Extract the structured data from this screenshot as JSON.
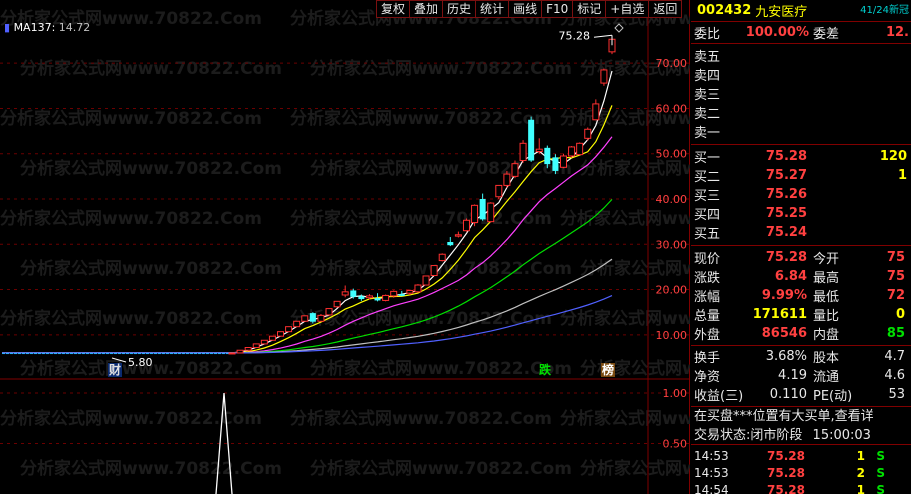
{
  "toolbar": [
    "复权",
    "叠加",
    "历史",
    "统计",
    "画线",
    "F10",
    "标记",
    "+自选",
    "返回"
  ],
  "ma_label": "MA137:",
  "ma_value": "14.72",
  "price_axis": [
    "70.00",
    "60.00",
    "50.00",
    "40.00",
    "30.00",
    "20.00",
    "10.00"
  ],
  "vol_axis": [
    "1.00",
    "0.50"
  ],
  "high_label": "75.28",
  "low_label": "5.80",
  "tags": {
    "cai": "财",
    "die": "跌",
    "bang": "榜"
  },
  "watermark": "分析家公式网www.70822.Com",
  "stock": {
    "code": "002432",
    "name": "九安医疗",
    "badge": "41/24新冠"
  },
  "weibi": {
    "label": "委比",
    "value": "100.00%",
    "label2": "委差",
    "value2": "12."
  },
  "sell": [
    "卖五",
    "卖四",
    "卖三",
    "卖二",
    "卖一"
  ],
  "buy": [
    {
      "label": "买一",
      "price": "75.28",
      "vol": "120"
    },
    {
      "label": "买二",
      "price": "75.27",
      "vol": "1"
    },
    {
      "label": "买三",
      "price": "75.26",
      "vol": ""
    },
    {
      "label": "买四",
      "price": "75.25",
      "vol": ""
    },
    {
      "label": "买五",
      "price": "75.24",
      "vol": ""
    }
  ],
  "quote": [
    {
      "l1": "现价",
      "v1": "75.28",
      "l2": "今开",
      "v2": "75"
    },
    {
      "l1": "涨跌",
      "v1": "6.84",
      "l2": "最高",
      "v2": "75"
    },
    {
      "l1": "涨幅",
      "v1": "9.99%",
      "l2": "最低",
      "v2": "72"
    },
    {
      "l1": "总量",
      "v1": "171611",
      "l2": "量比",
      "v2": "0"
    },
    {
      "l1": "外盘",
      "v1": "86546",
      "l2": "内盘",
      "v2": "85"
    }
  ],
  "stats": [
    {
      "l1": "换手",
      "v1": "3.68%",
      "l2": "股本",
      "v2": "4.7"
    },
    {
      "l1": "净资",
      "v1": "4.19",
      "l2": "流通",
      "v2": "4.6"
    },
    {
      "l1": "收益(三)",
      "v1": "0.110",
      "l2": "PE(动)",
      "v2": "53"
    }
  ],
  "msg1": "在买盘***位置有大买单,查看详",
  "msg2_label": "交易状态:",
  "msg2_value": "闭市阶段",
  "msg2_time": "15:00:03",
  "ticks": [
    {
      "time": "14:53",
      "price": "75.28",
      "vol": "1",
      "side": "S"
    },
    {
      "time": "14:53",
      "price": "75.28",
      "vol": "2",
      "side": "S"
    },
    {
      "time": "14:54",
      "price": "75.28",
      "vol": "1",
      "side": "S"
    }
  ],
  "chart_data": {
    "type": "candlestick",
    "ma_series": [
      {
        "name": "MA137",
        "last": 14.72
      }
    ],
    "candles": [
      {
        "o": 5.8,
        "c": 6.0,
        "h": 6.1,
        "l": 5.8
      },
      {
        "o": 6.0,
        "c": 6.6,
        "h": 6.6,
        "l": 6.0
      },
      {
        "o": 6.6,
        "c": 7.2,
        "h": 7.3,
        "l": 6.6
      },
      {
        "o": 7.2,
        "c": 8.0,
        "h": 8.0,
        "l": 7.2
      },
      {
        "o": 8.0,
        "c": 8.8,
        "h": 8.8,
        "l": 8.0
      },
      {
        "o": 8.8,
        "c": 9.7,
        "h": 9.7,
        "l": 8.8
      },
      {
        "o": 9.7,
        "c": 10.7,
        "h": 10.7,
        "l": 9.7
      },
      {
        "o": 10.7,
        "c": 11.8,
        "h": 11.8,
        "l": 10.7
      },
      {
        "o": 11.8,
        "c": 13.0,
        "h": 13.0,
        "l": 11.8
      },
      {
        "o": 13.0,
        "c": 14.2,
        "h": 14.3,
        "l": 13.0
      },
      {
        "o": 14.8,
        "c": 12.9,
        "h": 15.0,
        "l": 12.5
      },
      {
        "o": 13.0,
        "c": 14.3,
        "h": 14.6,
        "l": 12.9
      },
      {
        "o": 14.4,
        "c": 15.8,
        "h": 15.8,
        "l": 14.2
      },
      {
        "o": 16.2,
        "c": 17.4,
        "h": 17.4,
        "l": 16.0
      },
      {
        "o": 18.8,
        "c": 19.5,
        "h": 20.9,
        "l": 18.3
      },
      {
        "o": 19.8,
        "c": 18.4,
        "h": 20.2,
        "l": 18.0
      },
      {
        "o": 18.5,
        "c": 17.9,
        "h": 18.9,
        "l": 17.5
      },
      {
        "o": 18.2,
        "c": 18.6,
        "h": 19.0,
        "l": 17.8
      },
      {
        "o": 18.1,
        "c": 17.6,
        "h": 19.2,
        "l": 17.4
      },
      {
        "o": 17.6,
        "c": 18.7,
        "h": 18.9,
        "l": 17.4
      },
      {
        "o": 18.6,
        "c": 19.6,
        "h": 19.8,
        "l": 18.2
      },
      {
        "o": 19.0,
        "c": 18.6,
        "h": 19.7,
        "l": 18.5
      },
      {
        "o": 19.2,
        "c": 19.8,
        "h": 20.0,
        "l": 18.8
      },
      {
        "o": 19.5,
        "c": 21.0,
        "h": 21.2,
        "l": 19.3
      },
      {
        "o": 21.0,
        "c": 23.0,
        "h": 23.1,
        "l": 21.0
      },
      {
        "o": 23.1,
        "c": 25.3,
        "h": 25.3,
        "l": 23.1
      },
      {
        "o": 26.4,
        "c": 27.8,
        "h": 28.0,
        "l": 26.2
      },
      {
        "o": 30.5,
        "c": 29.8,
        "h": 31.6,
        "l": 29.6
      },
      {
        "o": 31.8,
        "c": 32.1,
        "h": 32.8,
        "l": 31.5
      },
      {
        "o": 33.0,
        "c": 35.3,
        "h": 35.7,
        "l": 32.8
      },
      {
        "o": 34.8,
        "c": 38.6,
        "h": 38.8,
        "l": 34.0
      },
      {
        "o": 40.0,
        "c": 35.5,
        "h": 41.2,
        "l": 35.2
      },
      {
        "o": 35.0,
        "c": 39.1,
        "h": 39.3,
        "l": 34.8
      },
      {
        "o": 40.5,
        "c": 43.0,
        "h": 43.1,
        "l": 40.0
      },
      {
        "o": 43.0,
        "c": 45.5,
        "h": 46.2,
        "l": 42.5
      },
      {
        "o": 45.0,
        "c": 47.8,
        "h": 48.5,
        "l": 44.6
      },
      {
        "o": 48.5,
        "c": 52.3,
        "h": 53.0,
        "l": 48.0
      },
      {
        "o": 57.5,
        "c": 48.5,
        "h": 58.2,
        "l": 48.2
      },
      {
        "o": 50.5,
        "c": 51.0,
        "h": 53.4,
        "l": 50.0
      },
      {
        "o": 51.3,
        "c": 47.7,
        "h": 51.8,
        "l": 46.8
      },
      {
        "o": 49.2,
        "c": 46.2,
        "h": 49.9,
        "l": 45.5
      },
      {
        "o": 47.0,
        "c": 49.5,
        "h": 50.0,
        "l": 46.8
      },
      {
        "o": 49.5,
        "c": 51.5,
        "h": 51.7,
        "l": 49.1
      },
      {
        "o": 49.8,
        "c": 52.3,
        "h": 52.5,
        "l": 49.8
      },
      {
        "o": 53.4,
        "c": 55.4,
        "h": 55.8,
        "l": 52.9
      },
      {
        "o": 57.5,
        "c": 61.0,
        "h": 62.0,
        "l": 57.5
      },
      {
        "o": 65.6,
        "c": 68.5,
        "h": 68.8,
        "l": 65.0
      },
      {
        "o": 72.5,
        "c": 75.28,
        "h": 75.28,
        "l": 72.0
      }
    ],
    "y_ticks": [
      70,
      60,
      50,
      40,
      30,
      20,
      10
    ],
    "ylim": [
      4,
      76
    ],
    "volume_ticks": [
      1.0,
      0.5
    ],
    "volume_ylim": [
      0,
      1.05
    ],
    "volume_spike_index": 16
  }
}
